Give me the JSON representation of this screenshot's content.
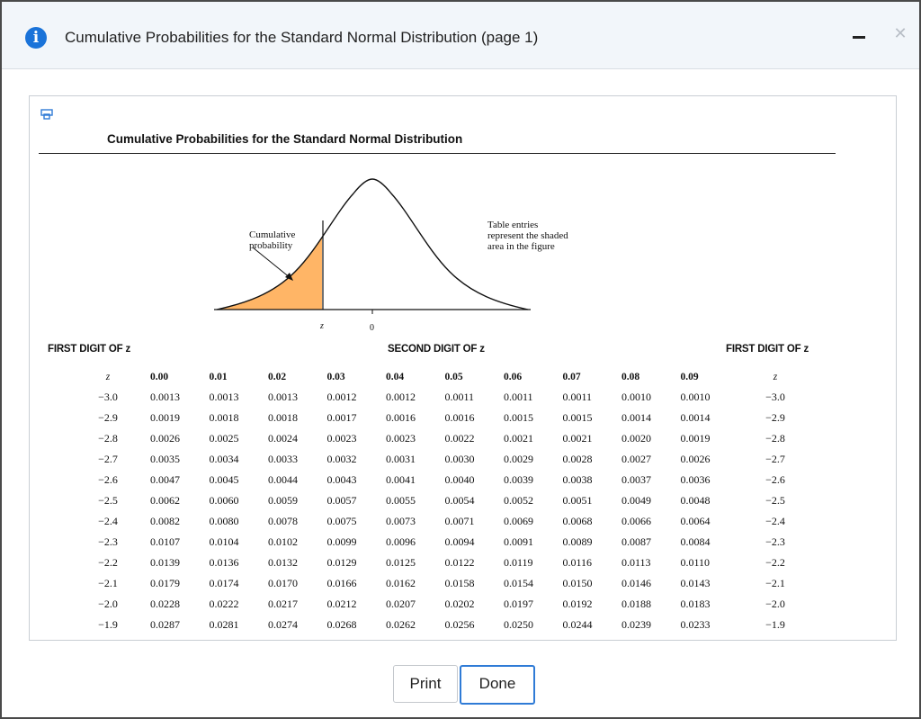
{
  "dialog": {
    "title": "Cumulative Probabilities for the Standard Normal Distribution (page 1)",
    "icon": "info-icon"
  },
  "document": {
    "title": "Cumulative Probabilities for the Standard Normal Distribution",
    "figure": {
      "cumulative_label_line1": "Cumulative",
      "cumulative_label_line2": "probability",
      "table_label_line1": "Table entries",
      "table_label_line2": "represent the shaded",
      "table_label_line3": "area in the figure",
      "z_label": "z",
      "zero_label": "0"
    },
    "first_digit_left": "FIRST DIGIT OF z",
    "second_digit": "SECOND DIGIT OF z",
    "first_digit_right": "FIRST DIGIT OF z",
    "headers": [
      "z",
      "0.00",
      "0.01",
      "0.02",
      "0.03",
      "0.04",
      "0.05",
      "0.06",
      "0.07",
      "0.08",
      "0.09",
      "z"
    ],
    "rows": [
      {
        "z": "−3.0",
        "vals": [
          "0.0013",
          "0.0013",
          "0.0013",
          "0.0012",
          "0.0012",
          "0.0011",
          "0.0011",
          "0.0011",
          "0.0010",
          "0.0010"
        ]
      },
      {
        "z": "−2.9",
        "vals": [
          "0.0019",
          "0.0018",
          "0.0018",
          "0.0017",
          "0.0016",
          "0.0016",
          "0.0015",
          "0.0015",
          "0.0014",
          "0.0014"
        ]
      },
      {
        "z": "−2.8",
        "vals": [
          "0.0026",
          "0.0025",
          "0.0024",
          "0.0023",
          "0.0023",
          "0.0022",
          "0.0021",
          "0.0021",
          "0.0020",
          "0.0019"
        ]
      },
      {
        "z": "−2.7",
        "vals": [
          "0.0035",
          "0.0034",
          "0.0033",
          "0.0032",
          "0.0031",
          "0.0030",
          "0.0029",
          "0.0028",
          "0.0027",
          "0.0026"
        ]
      },
      {
        "z": "−2.6",
        "vals": [
          "0.0047",
          "0.0045",
          "0.0044",
          "0.0043",
          "0.0041",
          "0.0040",
          "0.0039",
          "0.0038",
          "0.0037",
          "0.0036"
        ]
      },
      {
        "z": "−2.5",
        "vals": [
          "0.0062",
          "0.0060",
          "0.0059",
          "0.0057",
          "0.0055",
          "0.0054",
          "0.0052",
          "0.0051",
          "0.0049",
          "0.0048"
        ]
      },
      {
        "z": "−2.4",
        "vals": [
          "0.0082",
          "0.0080",
          "0.0078",
          "0.0075",
          "0.0073",
          "0.0071",
          "0.0069",
          "0.0068",
          "0.0066",
          "0.0064"
        ]
      },
      {
        "z": "−2.3",
        "vals": [
          "0.0107",
          "0.0104",
          "0.0102",
          "0.0099",
          "0.0096",
          "0.0094",
          "0.0091",
          "0.0089",
          "0.0087",
          "0.0084"
        ]
      },
      {
        "z": "−2.2",
        "vals": [
          "0.0139",
          "0.0136",
          "0.0132",
          "0.0129",
          "0.0125",
          "0.0122",
          "0.0119",
          "0.0116",
          "0.0113",
          "0.0110"
        ]
      },
      {
        "z": "−2.1",
        "vals": [
          "0.0179",
          "0.0174",
          "0.0170",
          "0.0166",
          "0.0162",
          "0.0158",
          "0.0154",
          "0.0150",
          "0.0146",
          "0.0143"
        ]
      },
      {
        "z": "−2.0",
        "vals": [
          "0.0228",
          "0.0222",
          "0.0217",
          "0.0212",
          "0.0207",
          "0.0202",
          "0.0197",
          "0.0192",
          "0.0188",
          "0.0183"
        ]
      },
      {
        "z": "−1.9",
        "vals": [
          "0.0287",
          "0.0281",
          "0.0274",
          "0.0268",
          "0.0262",
          "0.0256",
          "0.0250",
          "0.0244",
          "0.0239",
          "0.0233"
        ]
      }
    ]
  },
  "buttons": {
    "print_label": "Print",
    "done_label": "Done"
  },
  "colors": {
    "accent": "#2f7bd6",
    "info_icon": "#1a73d9",
    "shaded_area": "#ffb566"
  }
}
